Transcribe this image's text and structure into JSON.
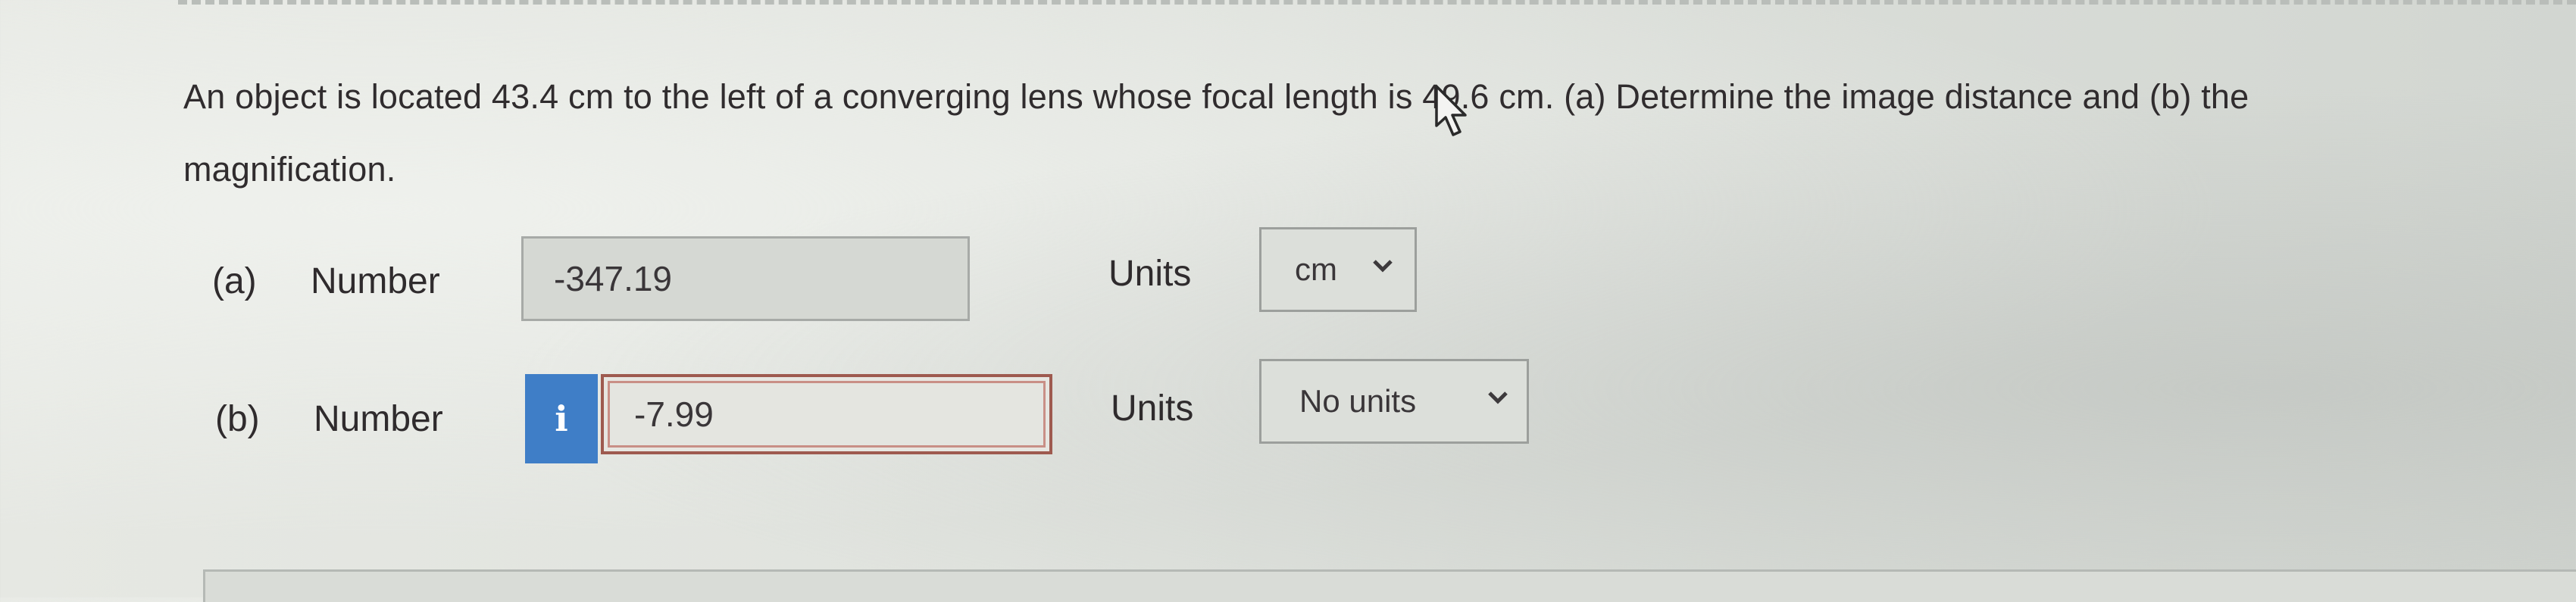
{
  "question": {
    "line1": "An object is located 43.4 cm to the left of a converging lens whose focal length is 49.6 cm. (a) Determine the image distance and (b) the",
    "line2": "magnification."
  },
  "part_a": {
    "label": "(a)",
    "number_label": "Number",
    "value": "-347.19",
    "units_label": "Units",
    "units_value": "cm"
  },
  "part_b": {
    "label": "(b)",
    "number_label": "Number",
    "info_icon_glyph": "i",
    "value": "-7.99",
    "units_label": "Units",
    "units_value": "No units"
  },
  "colors": {
    "info_badge": "#3f7ec7",
    "error_border": "#9e5a4f"
  },
  "icons": [
    "info-icon",
    "chevron-down-icon",
    "mouse-cursor-icon"
  ]
}
